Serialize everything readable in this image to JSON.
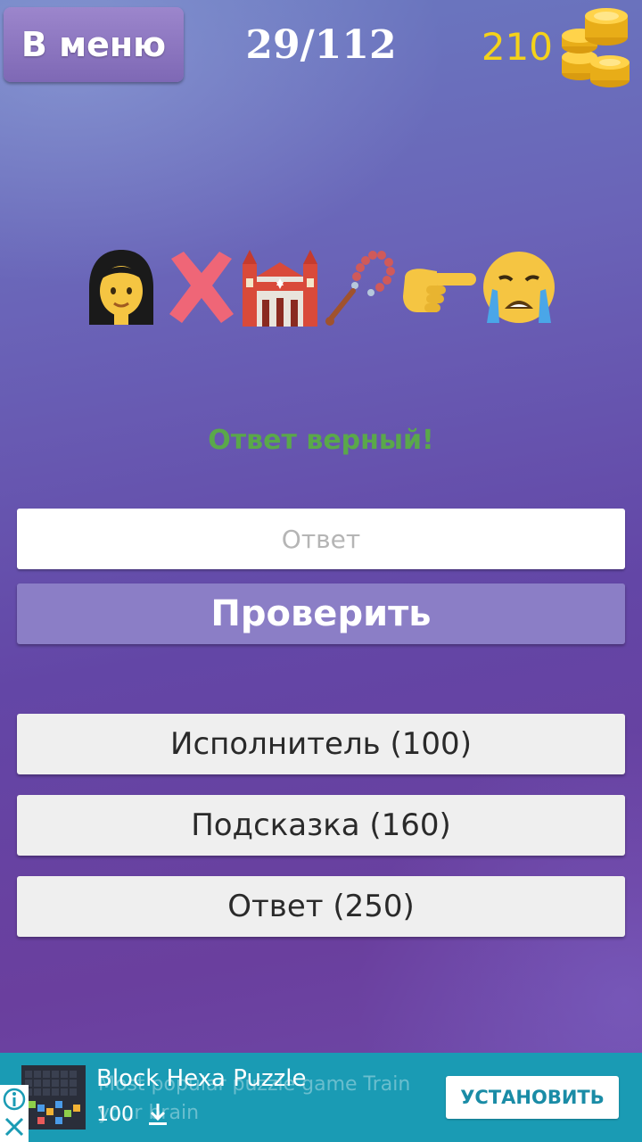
{
  "header": {
    "menu_label": "В меню",
    "progress": "29/112",
    "coins": "210",
    "coins_icon": "gold-coins-icon"
  },
  "puzzle": {
    "emojis": [
      "woman-icon",
      "cross-mark-icon",
      "synagogue-icon",
      "prayer-beads-icon",
      "pointing-right-icon",
      "crying-face-icon"
    ]
  },
  "feedback": "Ответ верный!",
  "answer": {
    "placeholder": "Ответ",
    "value": ""
  },
  "check_label": "Проверить",
  "hints": [
    {
      "label": "Исполнитель (100)"
    },
    {
      "label": "Подсказка (160)"
    },
    {
      "label": "Ответ (250)"
    }
  ],
  "ad": {
    "title": "Block Hexa Puzzle",
    "description": "Most popular puzzle game Train your brain",
    "rating": "100",
    "install_label": "УСТАНОВИТЬ",
    "background_color": "#1a9bb4"
  },
  "colors": {
    "coins_text": "#f4d21a",
    "feedback_text": "#5aa84a",
    "check_button": "#8b7ec6"
  }
}
